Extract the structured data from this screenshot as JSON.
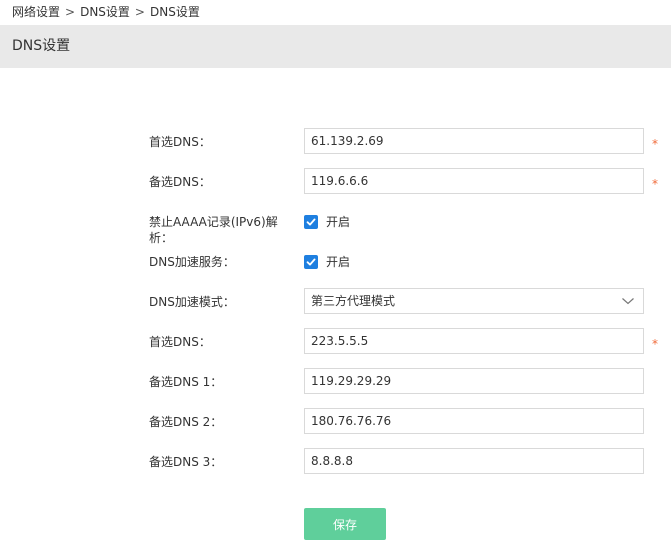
{
  "breadcrumb": {
    "items": [
      "网络设置",
      "DNS设置",
      "DNS设置"
    ],
    "separator": ">"
  },
  "page": {
    "title": "DNS设置"
  },
  "form": {
    "primary_dns": {
      "label": "首选DNS：",
      "value": "61.139.2.69",
      "required_mark": "*"
    },
    "secondary_dns": {
      "label": "备选DNS：",
      "value": "119.6.6.6",
      "required_mark": "*"
    },
    "disable_aaaa": {
      "label": "禁止AAAA记录(IPv6)解析：",
      "checked": true,
      "option_text": "开启"
    },
    "dns_acceleration": {
      "label": "DNS加速服务：",
      "checked": true,
      "option_text": "开启"
    },
    "acceleration_mode": {
      "label": "DNS加速模式：",
      "selected": "第三方代理模式"
    },
    "proxy_primary_dns": {
      "label": "首选DNS：",
      "value": "223.5.5.5",
      "required_mark": "*"
    },
    "proxy_backup_dns_1": {
      "label": "备选DNS 1：",
      "value": "119.29.29.29"
    },
    "proxy_backup_dns_2": {
      "label": "备选DNS 2：",
      "value": "180.76.76.76"
    },
    "proxy_backup_dns_3": {
      "label": "备选DNS 3：",
      "value": "8.8.8.8"
    },
    "save_label": "保存"
  },
  "colors": {
    "header_bg": "#e9e9e9",
    "checkbox_accent": "#1e7fe0",
    "required_mark": "#f06a3a",
    "save_button_bg": "#5fcf9b"
  },
  "icons": {
    "checkbox": "check-icon",
    "select": "chevron-down-icon"
  }
}
